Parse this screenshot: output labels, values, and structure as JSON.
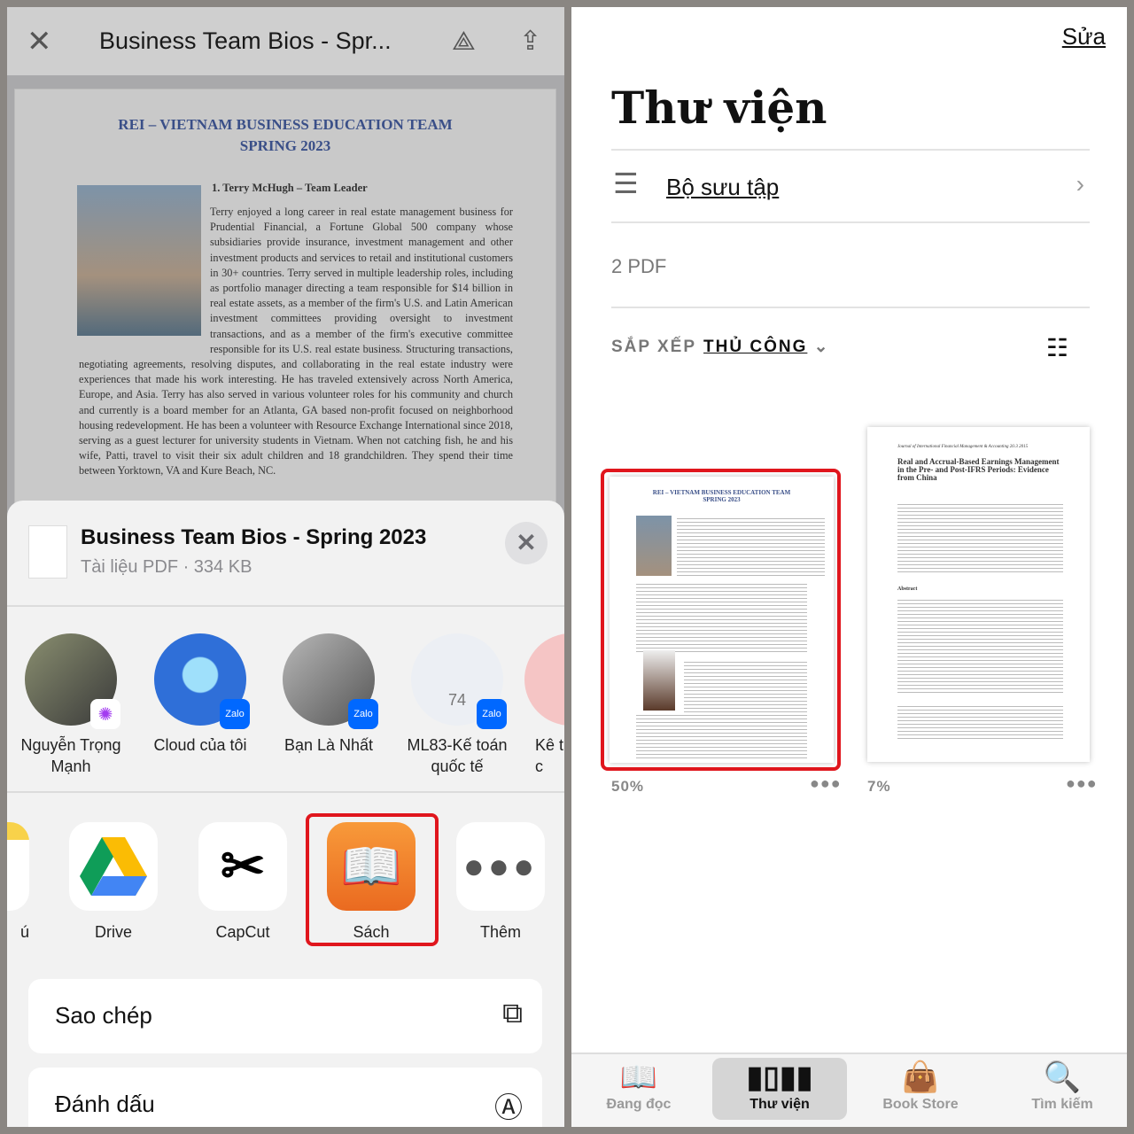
{
  "viewer": {
    "title": "Business Team Bios - Spr...",
    "close_icon": "close-icon",
    "drive_add_icon": "drive-add-icon",
    "share_icon": "share-icon"
  },
  "document": {
    "heading1": "REI – VIETNAM BUSINESS EDUCATION TEAM",
    "heading2": "SPRING 2023",
    "bio_title": "1.     Terry McHugh – Team Leader",
    "bio": "Terry enjoyed a long career in real estate management business for Prudential Financial, a Fortune Global 500 company whose subsidiaries provide insurance, investment management and other investment products and services to retail and institutional customers in 30+ countries. Terry served in multiple leadership roles, including as portfolio manager directing a team responsible for $14 billion in real estate assets, as a member of the firm's U.S. and Latin American investment committees providing oversight to investment transactions, and as a member of the firm's executive committee responsible for its U.S. real estate business. Structuring transactions, negotiating agreements, resolving disputes, and collaborating in the real estate industry were experiences that made his work interesting. He has traveled extensively across North America, Europe, and Asia. Terry has also served in various volunteer roles for his community and church and currently is a board member for an Atlanta, GA based non-profit focused on neighborhood housing redevelopment. He has been a volunteer with Resource Exchange International since 2018, serving as a guest lecturer for university students in Vietnam. When not catching fish, he and his wife, Patti, travel to visit their six adult children and 18 grandchildren. They spend their time between Yorktown, VA and Kure Beach, NC."
  },
  "share_sheet": {
    "file_title": "Business Team Bios - Spring 2023",
    "file_meta": "Tài liệu PDF · 334 KB",
    "contacts": [
      {
        "name": "Nguyễn Trọng Mạnh",
        "app": "Messenger"
      },
      {
        "name": "Cloud của tôi",
        "app": "Zalo"
      },
      {
        "name": "Bạn Là Nhất",
        "app": "Zalo"
      },
      {
        "name": "ML83-Kế toán quốc tế",
        "app": "Zalo",
        "group_count": "74"
      },
      {
        "name": "Kê tin c",
        "app": ""
      }
    ],
    "apps": [
      {
        "name": "ú"
      },
      {
        "name": "Drive"
      },
      {
        "name": "CapCut"
      },
      {
        "name": "Sách",
        "highlighted": true
      },
      {
        "name": "Thêm"
      }
    ],
    "actions": [
      {
        "label": "Sao chép",
        "icon": "copy-icon"
      },
      {
        "label": "Đánh dấu",
        "icon": "markup-icon"
      }
    ]
  },
  "library": {
    "edit": "Sửa",
    "title": "Thư viện",
    "collections": "Bộ sưu tập",
    "count": "2 PDF",
    "sort_label": "SẮP XẾP",
    "sort_value": "THỦ CÔNG",
    "books": [
      {
        "heading1": "REI – VIETNAM BUSINESS EDUCATION TEAM",
        "heading2": "SPRING 2023",
        "progress": "50%",
        "highlighted": true
      },
      {
        "journal": "Journal of International Financial Management & Accounting 26:3 2015",
        "title": "Real and Accrual-Based Earnings Management in the Pre- and Post-IFRS Periods: Evidence from China",
        "abstract": "Abstract",
        "progress": "7%"
      }
    ],
    "tabs": [
      {
        "label": "Đang đọc",
        "icon": "book-open-icon"
      },
      {
        "label": "Thư viện",
        "icon": "library-icon",
        "active": true
      },
      {
        "label": "Book Store",
        "icon": "shopping-bag-icon"
      },
      {
        "label": "Tìm kiếm",
        "icon": "search-icon"
      }
    ]
  },
  "colors": {
    "highlight": "#e0161d",
    "zalo": "#0068ff",
    "books_orange": "#f07a26"
  }
}
